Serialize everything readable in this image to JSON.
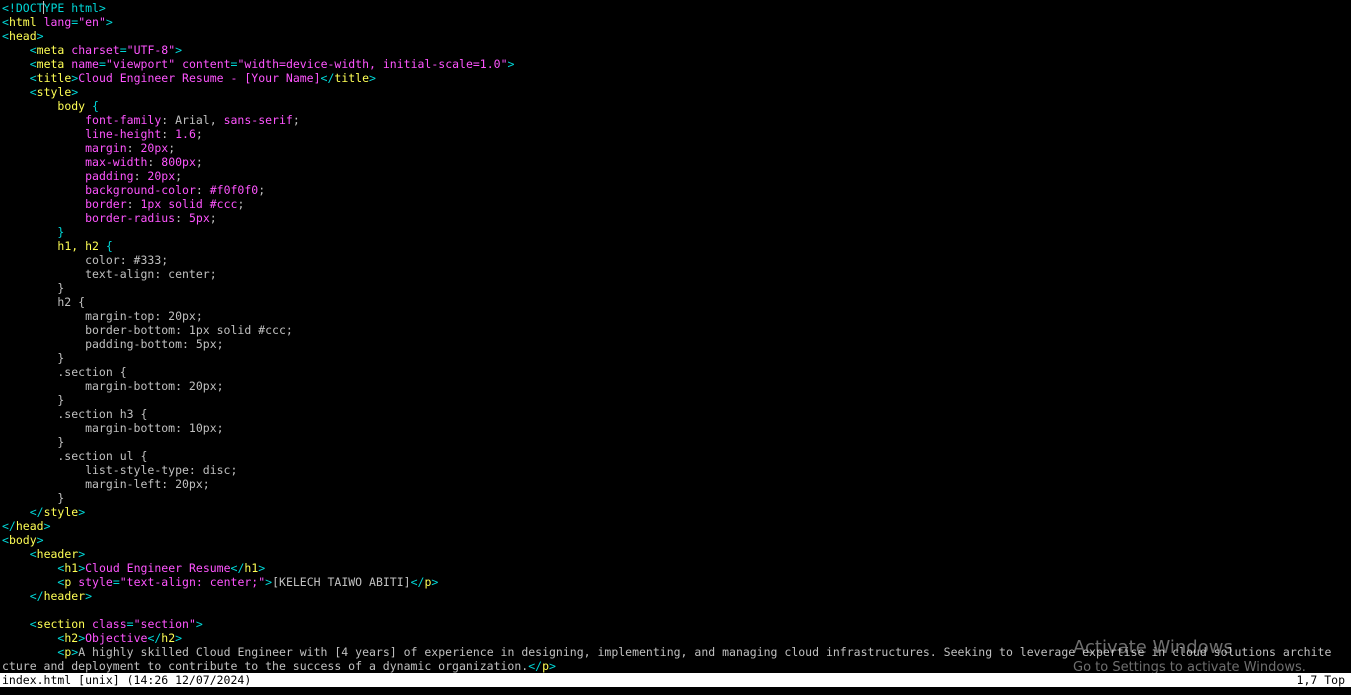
{
  "editor": {
    "lines": [
      [
        [
          "tag",
          "<!DOCTYPE html>"
        ]
      ],
      [
        [
          "tag",
          "<"
        ],
        [
          "tagname",
          "html"
        ],
        [
          "attr",
          " lang"
        ],
        [
          "tag",
          "="
        ],
        [
          "str",
          "\"en\""
        ],
        [
          "tag",
          ">"
        ]
      ],
      [
        [
          "tag",
          "<"
        ],
        [
          "tagname",
          "head"
        ],
        [
          "tag",
          ">"
        ]
      ],
      [
        [
          "plain",
          "    "
        ],
        [
          "tag",
          "<"
        ],
        [
          "tagname",
          "meta"
        ],
        [
          "attr",
          " charset"
        ],
        [
          "tag",
          "="
        ],
        [
          "str",
          "\"UTF-8\""
        ],
        [
          "tag",
          ">"
        ]
      ],
      [
        [
          "plain",
          "    "
        ],
        [
          "tag",
          "<"
        ],
        [
          "tagname",
          "meta"
        ],
        [
          "attr",
          " name"
        ],
        [
          "tag",
          "="
        ],
        [
          "str",
          "\"viewport\""
        ],
        [
          "attr",
          " content"
        ],
        [
          "tag",
          "="
        ],
        [
          "str",
          "\"width=device-width, initial-scale=1.0\""
        ],
        [
          "tag",
          ">"
        ]
      ],
      [
        [
          "plain",
          "    "
        ],
        [
          "tag",
          "<"
        ],
        [
          "tagname",
          "title"
        ],
        [
          "tag",
          ">"
        ],
        [
          "text",
          "Cloud Engineer Resume - [Your Name]"
        ],
        [
          "tag",
          "</"
        ],
        [
          "tagname",
          "title"
        ],
        [
          "tag",
          ">"
        ]
      ],
      [
        [
          "plain",
          "    "
        ],
        [
          "tag",
          "<"
        ],
        [
          "tagname",
          "style"
        ],
        [
          "tag",
          ">"
        ]
      ],
      [
        [
          "plain",
          "        "
        ],
        [
          "selector",
          "body"
        ],
        [
          "punc",
          " {"
        ]
      ],
      [
        [
          "plain",
          "            "
        ],
        [
          "cssprop",
          "font-family"
        ],
        [
          "default",
          ": Arial, "
        ],
        [
          "cssprop",
          "sans-serif"
        ],
        [
          "default",
          ";"
        ]
      ],
      [
        [
          "plain",
          "            "
        ],
        [
          "cssprop",
          "line-height"
        ],
        [
          "default",
          ": "
        ],
        [
          "cssprop",
          "1.6"
        ],
        [
          "default",
          ";"
        ]
      ],
      [
        [
          "plain",
          "            "
        ],
        [
          "cssprop",
          "margin"
        ],
        [
          "default",
          ": "
        ],
        [
          "cssprop",
          "20px"
        ],
        [
          "default",
          ";"
        ]
      ],
      [
        [
          "plain",
          "            "
        ],
        [
          "cssprop",
          "max-width"
        ],
        [
          "default",
          ": "
        ],
        [
          "cssprop",
          "800px"
        ],
        [
          "default",
          ";"
        ]
      ],
      [
        [
          "plain",
          "            "
        ],
        [
          "cssprop",
          "padding"
        ],
        [
          "default",
          ": "
        ],
        [
          "cssprop",
          "20px"
        ],
        [
          "default",
          ";"
        ]
      ],
      [
        [
          "plain",
          "            "
        ],
        [
          "cssprop",
          "background-color"
        ],
        [
          "default",
          ": "
        ],
        [
          "cssprop",
          "#f0f0f0"
        ],
        [
          "default",
          ";"
        ]
      ],
      [
        [
          "plain",
          "            "
        ],
        [
          "cssprop",
          "border"
        ],
        [
          "default",
          ": "
        ],
        [
          "cssprop",
          "1px solid #ccc"
        ],
        [
          "default",
          ";"
        ]
      ],
      [
        [
          "plain",
          "            "
        ],
        [
          "cssprop",
          "border-radius"
        ],
        [
          "default",
          ": "
        ],
        [
          "cssprop",
          "5px"
        ],
        [
          "default",
          ";"
        ]
      ],
      [
        [
          "plain",
          "        "
        ],
        [
          "punc",
          "}"
        ]
      ],
      [
        [
          "plain",
          "        "
        ],
        [
          "selector",
          "h1, h2"
        ],
        [
          "punc",
          " {"
        ]
      ],
      [
        [
          "plain",
          "            color: #333;"
        ]
      ],
      [
        [
          "plain",
          "            text-align: center;"
        ]
      ],
      [
        [
          "plain",
          "        }"
        ]
      ],
      [
        [
          "plain",
          "        h2 {"
        ]
      ],
      [
        [
          "plain",
          "            margin-top: 20px;"
        ]
      ],
      [
        [
          "plain",
          "            border-bottom: 1px solid #ccc;"
        ]
      ],
      [
        [
          "plain",
          "            padding-bottom: 5px;"
        ]
      ],
      [
        [
          "plain",
          "        }"
        ]
      ],
      [
        [
          "plain",
          "        .section {"
        ]
      ],
      [
        [
          "plain",
          "            margin-bottom: 20px;"
        ]
      ],
      [
        [
          "plain",
          "        }"
        ]
      ],
      [
        [
          "plain",
          "        .section h3 {"
        ]
      ],
      [
        [
          "plain",
          "            margin-bottom: 10px;"
        ]
      ],
      [
        [
          "plain",
          "        }"
        ]
      ],
      [
        [
          "plain",
          "        .section ul {"
        ]
      ],
      [
        [
          "plain",
          "            list-style-type: disc;"
        ]
      ],
      [
        [
          "plain",
          "            margin-left: 20px;"
        ]
      ],
      [
        [
          "plain",
          "        }"
        ]
      ],
      [
        [
          "plain",
          "    "
        ],
        [
          "tag",
          "</"
        ],
        [
          "tagname",
          "style"
        ],
        [
          "tag",
          ">"
        ]
      ],
      [
        [
          "tag",
          "</"
        ],
        [
          "tagname",
          "head"
        ],
        [
          "tag",
          ">"
        ]
      ],
      [
        [
          "tag",
          "<"
        ],
        [
          "tagname",
          "body"
        ],
        [
          "tag",
          ">"
        ]
      ],
      [
        [
          "plain",
          "    "
        ],
        [
          "tag",
          "<"
        ],
        [
          "tagname",
          "header"
        ],
        [
          "tag",
          ">"
        ]
      ],
      [
        [
          "plain",
          "        "
        ],
        [
          "tag",
          "<"
        ],
        [
          "tagname",
          "h1"
        ],
        [
          "tag",
          ">"
        ],
        [
          "text",
          "Cloud Engineer Resume"
        ],
        [
          "tag",
          "</"
        ],
        [
          "tagname",
          "h1"
        ],
        [
          "tag",
          ">"
        ]
      ],
      [
        [
          "plain",
          "        "
        ],
        [
          "tag",
          "<"
        ],
        [
          "tagname",
          "p"
        ],
        [
          "attr",
          " style"
        ],
        [
          "tag",
          "="
        ],
        [
          "str",
          "\"text-align: center;\""
        ],
        [
          "tag",
          ">"
        ],
        [
          "plain",
          "[KELECH TAIWO ABITI]"
        ],
        [
          "tag",
          "</"
        ],
        [
          "tagname",
          "p"
        ],
        [
          "tag",
          ">"
        ]
      ],
      [
        [
          "plain",
          "    "
        ],
        [
          "tag",
          "</"
        ],
        [
          "tagname",
          "header"
        ],
        [
          "tag",
          ">"
        ]
      ],
      [],
      [
        [
          "plain",
          "    "
        ],
        [
          "tag",
          "<"
        ],
        [
          "tagname",
          "section"
        ],
        [
          "attr",
          " class"
        ],
        [
          "tag",
          "="
        ],
        [
          "str",
          "\"section\""
        ],
        [
          "tag",
          ">"
        ]
      ],
      [
        [
          "plain",
          "        "
        ],
        [
          "tag",
          "<"
        ],
        [
          "tagname",
          "h2"
        ],
        [
          "tag",
          ">"
        ],
        [
          "text",
          "Objective"
        ],
        [
          "tag",
          "</"
        ],
        [
          "tagname",
          "h2"
        ],
        [
          "tag",
          ">"
        ]
      ],
      [
        [
          "plain",
          "        "
        ],
        [
          "tag",
          "<"
        ],
        [
          "tagname",
          "p"
        ],
        [
          "tag",
          ">"
        ],
        [
          "plain",
          "A highly skilled Cloud Engineer with [4 years] of experience in designing, implementing, and managing cloud infrastructures. Seeking to leverage expertise in cloud solutions archite"
        ]
      ],
      [
        [
          "plain",
          "cture and deployment to contribute to the success of a dynamic organization."
        ],
        [
          "tag",
          "</"
        ],
        [
          "tagname",
          "p"
        ],
        [
          "tag",
          ">"
        ]
      ]
    ]
  },
  "statusbar": {
    "file_info": "index.html [unix] (14:26 12/07/2024)",
    "position": "1,7 Top"
  },
  "watermark": {
    "title": "Activate Windows",
    "subtitle": "Go to Settings to activate Windows."
  },
  "colors": {
    "background": "#000000",
    "tag": "#00d7d7",
    "tagname": "#ffff55",
    "attribute": "#ff55ff",
    "string": "#ff55ff",
    "text": "#c0c0c0",
    "statusbar_bg": "#ffffff",
    "statusbar_fg": "#000000"
  }
}
